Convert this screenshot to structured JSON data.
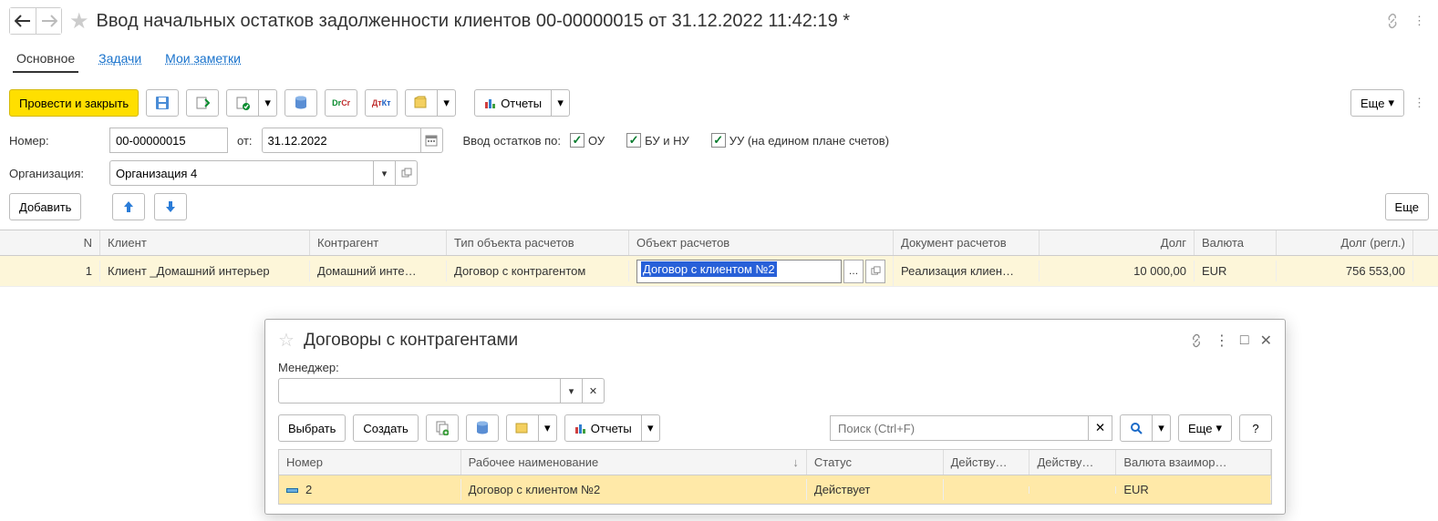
{
  "title": "Ввод начальных остатков задолженности клиентов 00-00000015 от 31.12.2022 11:42:19 *",
  "tabs": {
    "main": "Основное",
    "tasks": "Задачи",
    "notes": "Мои заметки"
  },
  "toolbar": {
    "post_close": "Провести и закрыть",
    "reports": "Отчеты",
    "more": "Еще"
  },
  "form": {
    "number_label": "Номер:",
    "number": "00-00000015",
    "from_label": "от:",
    "date": "31.12.2022",
    "balances_label": "Ввод остатков по:",
    "chk_ou": "ОУ",
    "chk_bunu": "БУ и НУ",
    "chk_uu": "УУ (на едином плане счетов)",
    "org_label": "Организация:",
    "org": "Организация 4",
    "add": "Добавить",
    "more2": "Еще"
  },
  "grid": {
    "head": {
      "n": "N",
      "client": "Клиент",
      "ka": "Контрагент",
      "type": "Тип объекта расчетов",
      "obj": "Объект расчетов",
      "doc": "Документ расчетов",
      "debt": "Долг",
      "cur": "Валюта",
      "debtr": "Долг (регл.)"
    },
    "row": {
      "n": "1",
      "client": "Клиент _Домашний интерьер",
      "ka": "Домашний инте…",
      "type": "Договор с контрагентом",
      "obj": "Договор с клиентом №2",
      "doc": "Реализация клиен…",
      "debt": "10 000,00",
      "cur": "EUR",
      "debtr": "756 553,00"
    }
  },
  "popup": {
    "title": "Договоры с контрагентами",
    "manager_label": "Менеджер:",
    "select": "Выбрать",
    "create": "Создать",
    "reports": "Отчеты",
    "search_placeholder": "Поиск (Ctrl+F)",
    "more": "Еще",
    "help": "?",
    "head": {
      "num": "Номер",
      "name": "Рабочее наименование",
      "status": "Статус",
      "a1": "Действу…",
      "a2": "Действу…",
      "cur": "Валюта взаимор…"
    },
    "row": {
      "num": "2",
      "name": "Договор с клиентом №2",
      "status": "Действует",
      "a1": "",
      "a2": "",
      "cur": "EUR"
    }
  }
}
